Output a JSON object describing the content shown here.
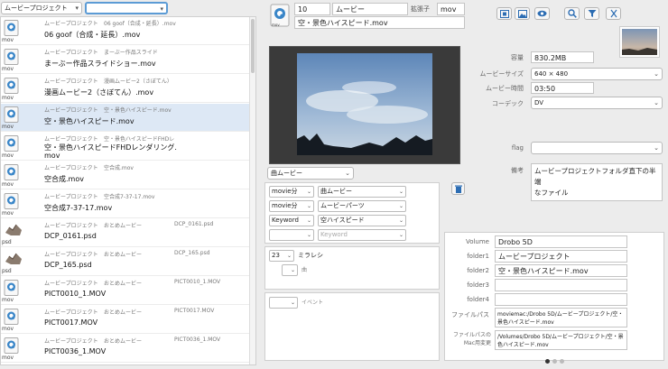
{
  "left_panel": {
    "filter_select": "ムービープロジェクト",
    "filter_select2": "",
    "rows": [
      {
        "ext": "mov",
        "meta1": "ムービープロジェクト",
        "meta2": "06 goof（合成・延長）.mov",
        "meta3": "",
        "title": "06 goof（合成・延長）.mov",
        "icon": "quicktime-file-icon"
      },
      {
        "ext": "mov",
        "meta1": "ムービープロジェクト",
        "meta2": "まーぶー作品スライド",
        "meta3": "",
        "title": "まーぶー作品スライドショー.mov",
        "icon": "quicktime-file-icon"
      },
      {
        "ext": "mov",
        "meta1": "ムービープロジェクト",
        "meta2": "漫画ムービー2（さぼてん）",
        "meta3": "",
        "title": "漫画ムービー2（さぼてん）.mov",
        "icon": "quicktime-file-icon"
      },
      {
        "ext": "mov",
        "meta1": "ムービープロジェクト",
        "meta2": "空・景色ハイスピード.mov",
        "meta3": "",
        "title": "空・景色ハイスピード.mov",
        "icon": "quicktime-file-icon"
      },
      {
        "ext": "mov",
        "meta1": "ムービープロジェクト",
        "meta2": "空・景色ハイスピードFHDレ",
        "meta3": "",
        "title": "空・景色ハイスピードFHDレンダリング.",
        "title2": "mov",
        "icon": "quicktime-file-icon"
      },
      {
        "ext": "mov",
        "meta1": "ムービープロジェクト",
        "meta2": "空合成.mov",
        "meta3": "",
        "title": "空合成.mov",
        "icon": "quicktime-file-icon"
      },
      {
        "ext": "mov",
        "meta1": "ムービープロジェクト",
        "meta2": "空合成7-37-17.mov",
        "meta3": "",
        "title": "空合成7-37-17.mov",
        "icon": "quicktime-file-icon"
      },
      {
        "ext": "psd",
        "meta1": "ムービープロジェクト",
        "meta2": "おとめムービー",
        "meta3": "DCP_0161.psd",
        "title": "DCP_0161.psd",
        "icon": "psd-thumbnail-icon"
      },
      {
        "ext": "psd",
        "meta1": "ムービープロジェクト",
        "meta2": "おとめムービー",
        "meta3": "DCP_165.psd",
        "title": "DCP_165.psd",
        "icon": "psd-thumbnail-icon"
      },
      {
        "ext": "mov",
        "meta1": "ムービープロジェクト",
        "meta2": "おとめムービー",
        "meta3": "PICT0010_1.MOV",
        "title": "PICT0010_1.MOV",
        "icon": "quicktime-file-icon"
      },
      {
        "ext": "mov",
        "meta1": "ムービープロジェクト",
        "meta2": "おとめムービー",
        "meta3": "PICT0017.MOV",
        "title": "PICT0017.MOV",
        "icon": "quicktime-file-icon"
      },
      {
        "ext": "mov",
        "meta1": "ムービープロジェクト",
        "meta2": "おとめムービー",
        "meta3": "PICT0036_1.MOV",
        "title": "PICT0036_1.MOV",
        "icon": "quicktime-file-icon"
      }
    ],
    "selected_index": 3
  },
  "detail": {
    "number": "10",
    "type": "ムービー",
    "ext_label": "拡張子",
    "ext_value": "mov",
    "filename": "空・景色ハイスピード.mov",
    "file_ext_badge": "mov"
  },
  "toolbar": {
    "buttons": [
      "film-icon",
      "image-icon",
      "eye-icon",
      "search-icon",
      "filter-icon",
      "tools-icon"
    ]
  },
  "properties": {
    "capacity_label": "容量",
    "capacity_value": "830.2MB",
    "movie_size_label": "ムービーサイズ",
    "movie_size_value": "640 × 480",
    "movie_time_label": "ムービー時間",
    "movie_time_value": "03:50",
    "codec_label": "コーデック",
    "codec_value": "DV",
    "flag_label": "flag",
    "flag_value": "",
    "note_label": "備考",
    "note_value_line1": "ムービープロジェクトフォルダ直下の半端",
    "note_value_line2": "なファイル"
  },
  "keywords": {
    "category_select": "曲ムービー",
    "rows": [
      {
        "a": "movie分",
        "b": "曲ムービー"
      },
      {
        "a": "movie分",
        "b": "ムービーパーツ"
      },
      {
        "a": "Keyword",
        "b": "空ハイスピード"
      },
      {
        "a": "",
        "b": "",
        "b_placeholder": "Keyword"
      }
    ]
  },
  "music": {
    "number": "23",
    "artist": "ミラレシ",
    "song_label": "曲"
  },
  "event": {
    "label": "イベント"
  },
  "location": {
    "volume_label": "Volume",
    "volume_value": "Drobo 5D",
    "folder1_label": "folder1",
    "folder1_value": "ムービープロジェクト",
    "folder2_label": "folder2",
    "folder2_value": "空・景色ハイスピード.mov",
    "folder3_label": "folder3",
    "folder3_value": "",
    "folder4_label": "folder4",
    "folder4_value": "",
    "filepath_label": "ファイルパス",
    "filepath_value_line1": "moviemac:/Drobo 5D/ムービープロジェクト/空・",
    "filepath_value_line2": "景色ハイスピード.mov",
    "macpath_label_line1": "ファイルパスの",
    "macpath_label_line2": "Mac用変更",
    "macpath_value_line1": "/Volumes/Drobo 5D/ムービープロジェクト/空・景",
    "macpath_value_line2": "色ハイスピード.mov"
  },
  "pager": {
    "dots": 3,
    "active": 0
  }
}
